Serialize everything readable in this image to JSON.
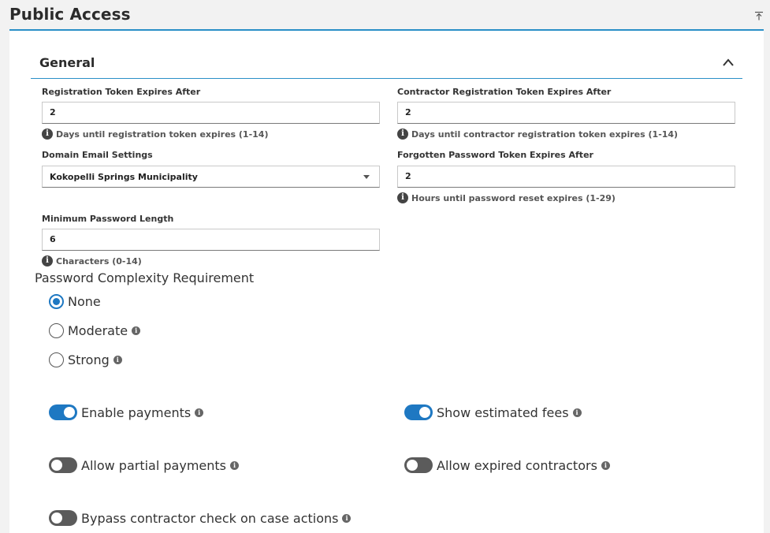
{
  "page": {
    "title": "Public Access"
  },
  "section": {
    "title": "General"
  },
  "fields": {
    "registration_token": {
      "label": "Registration Token Expires After",
      "value": "2",
      "hint": "Days until registration token expires (1-14)"
    },
    "contractor_registration_token": {
      "label": "Contractor Registration Token Expires After",
      "value": "2",
      "hint": "Days until contractor registration token expires (1-14)"
    },
    "domain_email_settings": {
      "label": "Domain Email Settings",
      "value": "Kokopelli Springs Municipality"
    },
    "forgotten_password_token": {
      "label": "Forgotten Password Token Expires After",
      "value": "2",
      "hint": "Hours until password reset expires (1-29)"
    },
    "minimum_password_length": {
      "label": "Minimum Password Length",
      "value": "6",
      "hint": "Characters (0-14)"
    }
  },
  "password_complexity": {
    "label": "Password Complexity Requirement",
    "options": [
      {
        "label": "None",
        "selected": true
      },
      {
        "label": "Moderate",
        "selected": false
      },
      {
        "label": "Strong",
        "selected": false
      }
    ]
  },
  "toggles": {
    "enable_payments": {
      "label": "Enable payments",
      "on": true
    },
    "show_estimated_fees": {
      "label": "Show estimated fees",
      "on": true
    },
    "allow_partial_payments": {
      "label": "Allow partial payments",
      "on": false
    },
    "allow_expired_contractors": {
      "label": "Allow expired contractors",
      "on": false
    },
    "bypass_contractor_check": {
      "label": "Bypass contractor check on case actions",
      "on": false
    }
  },
  "colors": {
    "accent": "#1e78c2",
    "rule": "#2a8fc7",
    "toggle_off": "#5b5b5b"
  },
  "icons": {
    "info": "info-icon",
    "collapse": "chevron-up-icon",
    "collapse_all": "collapse-top-icon"
  }
}
